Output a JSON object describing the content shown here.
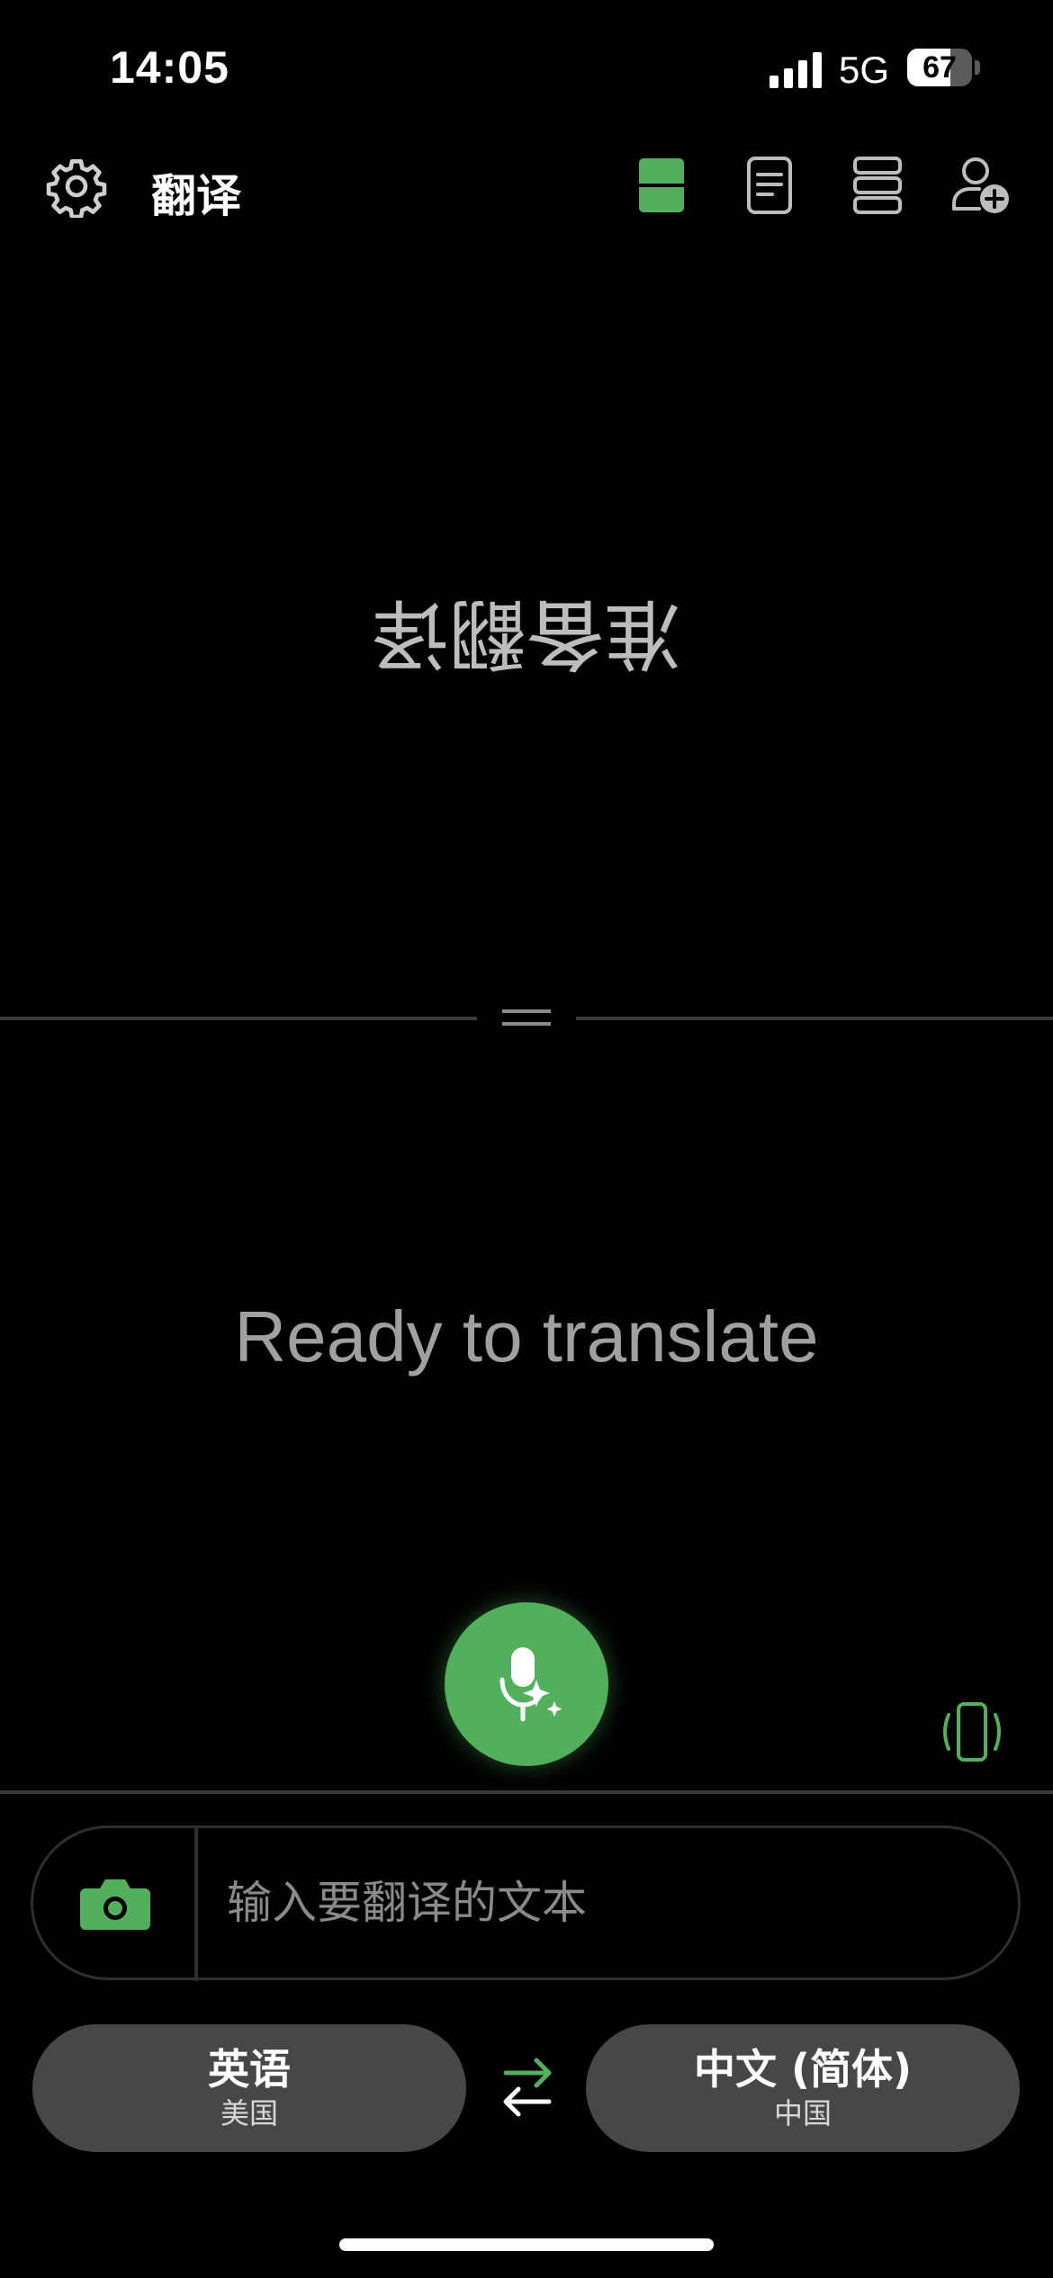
{
  "status_bar": {
    "time": "14:05",
    "network": "5G",
    "battery_percent": "67",
    "battery_level": 0.67
  },
  "header": {
    "title": "翻译",
    "icons": [
      "gear-icon",
      "split-view-icon",
      "document-icon",
      "stacked-list-icon",
      "add-user-icon"
    ]
  },
  "top_panel": {
    "mirrored_text": "准备翻译"
  },
  "bottom_panel": {
    "ready_text": "Ready to translate"
  },
  "input": {
    "placeholder": "输入要翻译的文本",
    "value": ""
  },
  "source_language": {
    "name": "英语",
    "region": "美国"
  },
  "target_language": {
    "name": "中文 (简体)",
    "region": "中国"
  },
  "colors": {
    "accent": "#52b05c",
    "background": "#000000",
    "pill": "#474747"
  }
}
